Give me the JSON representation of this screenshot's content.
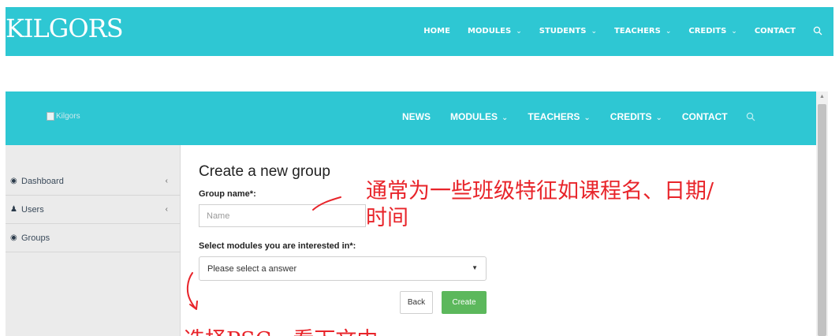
{
  "site": {
    "logo_text": "KILGORS",
    "nav": [
      {
        "label": "HOME",
        "dropdown": false
      },
      {
        "label": "MODULES",
        "dropdown": true
      },
      {
        "label": "STUDENTS",
        "dropdown": true
      },
      {
        "label": "TEACHERS",
        "dropdown": true
      },
      {
        "label": "CREDITS",
        "dropdown": true
      },
      {
        "label": "CONTACT",
        "dropdown": false
      }
    ],
    "dropdown_glyph": "⌄",
    "search_icon": "search-icon"
  },
  "inner": {
    "brand_alt": "Kilgors",
    "nav": [
      {
        "label": "NEWS",
        "dropdown": false
      },
      {
        "label": "MODULES",
        "dropdown": true
      },
      {
        "label": "TEACHERS",
        "dropdown": true
      },
      {
        "label": "CREDITS",
        "dropdown": true
      },
      {
        "label": "CONTACT",
        "dropdown": false
      }
    ],
    "dropdown_glyph": "⌄"
  },
  "sidebar": {
    "items": [
      {
        "label": "Dashboard",
        "icon": "dashboard-icon",
        "glyph": "◉",
        "has_arrow": true
      },
      {
        "label": "Users",
        "icon": "user-icon",
        "glyph": "♟",
        "has_arrow": true
      },
      {
        "label": "Groups",
        "icon": "groups-icon",
        "glyph": "◉",
        "has_arrow": false
      }
    ],
    "arrow_glyph": "‹"
  },
  "form": {
    "title": "Create a new group",
    "group_name_label": "Group name*:",
    "group_name_placeholder": "Name",
    "group_name_value": "",
    "modules_label": "Select modules you are interested in*:",
    "modules_selected": "Please select a answer",
    "back_label": "Back",
    "create_label": "Create"
  },
  "annotations": {
    "note1_line1": "通常为一些班级特征如课程名、日期/",
    "note1_line2": "时间",
    "note2_partial": "选择PSC，看下文中"
  },
  "colors": {
    "header_teal": "#2ec7d3",
    "create_green": "#5cb85c",
    "annotation_red": "#e8242a",
    "sidebar_bg": "#ebebeb"
  }
}
